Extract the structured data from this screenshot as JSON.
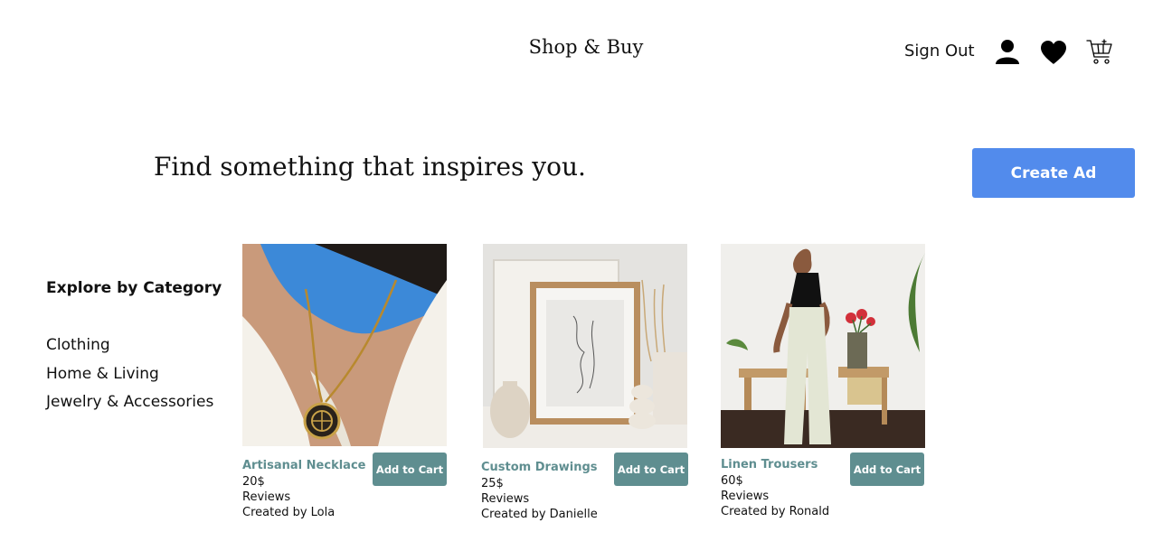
{
  "header": {
    "brand": "Shop & Buy",
    "sign_out": "Sign Out",
    "icons": [
      "user-icon",
      "heart-icon",
      "cart-icon"
    ]
  },
  "hero": {
    "headline": "Find something that inspires you.",
    "create_ad_label": "Create Ad"
  },
  "categories": {
    "title": "Explore by Category",
    "items": [
      "Clothing",
      "Home & Living",
      "Jewelry & Accessories"
    ]
  },
  "products": [
    {
      "name": "Artisanal Necklace",
      "price": "20$",
      "reviews": "Reviews",
      "creator": "Created by Lola",
      "add_label": "Add to Cart"
    },
    {
      "name": "Custom Drawings",
      "price": "25$",
      "reviews": "Reviews",
      "creator": "Created by Danielle",
      "add_label": "Add to Cart"
    },
    {
      "name": "Linen Trousers",
      "price": "60$",
      "reviews": "Reviews",
      "creator": "Created by Ronald",
      "add_label": "Add to Cart"
    }
  ],
  "colors": {
    "accent_blue": "#528bec",
    "accent_teal": "#5f8e90"
  }
}
